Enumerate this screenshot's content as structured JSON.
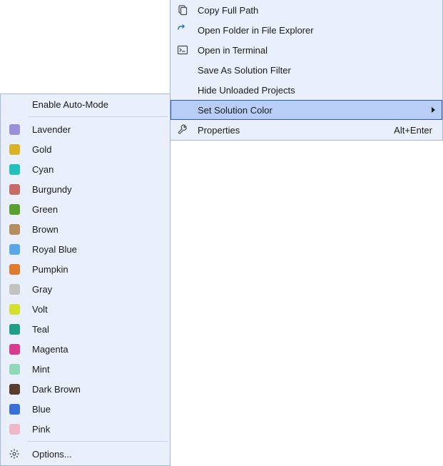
{
  "main_menu": {
    "copy_full_path": "Copy Full Path",
    "open_folder": "Open Folder in File Explorer",
    "open_terminal": "Open in Terminal",
    "save_filter": "Save As Solution Filter",
    "hide_unloaded": "Hide Unloaded Projects",
    "set_solution_color": "Set Solution Color",
    "properties": "Properties",
    "properties_shortcut": "Alt+Enter"
  },
  "submenu": {
    "enable_auto": "Enable Auto-Mode",
    "options": "Options...",
    "colors": [
      {
        "label": "Lavender",
        "swatch": "#9a8fd9"
      },
      {
        "label": "Gold",
        "swatch": "#d9b321"
      },
      {
        "label": "Cyan",
        "swatch": "#22bfbf"
      },
      {
        "label": "Burgundy",
        "swatch": "#c96a6a"
      },
      {
        "label": "Green",
        "swatch": "#5aa02c"
      },
      {
        "label": "Brown",
        "swatch": "#b88d5e"
      },
      {
        "label": "Royal Blue",
        "swatch": "#5aa7e8"
      },
      {
        "label": "Pumpkin",
        "swatch": "#e07a2c"
      },
      {
        "label": "Gray",
        "swatch": "#c2c2c2"
      },
      {
        "label": "Volt",
        "swatch": "#d4e02c"
      },
      {
        "label": "Teal",
        "swatch": "#1f9e8a"
      },
      {
        "label": "Magenta",
        "swatch": "#d93a8f"
      },
      {
        "label": "Mint",
        "swatch": "#8fd9b8"
      },
      {
        "label": "Dark Brown",
        "swatch": "#5a3c2e"
      },
      {
        "label": "Blue",
        "swatch": "#3a6fd9"
      },
      {
        "label": "Pink",
        "swatch": "#f0b8c7"
      }
    ]
  }
}
